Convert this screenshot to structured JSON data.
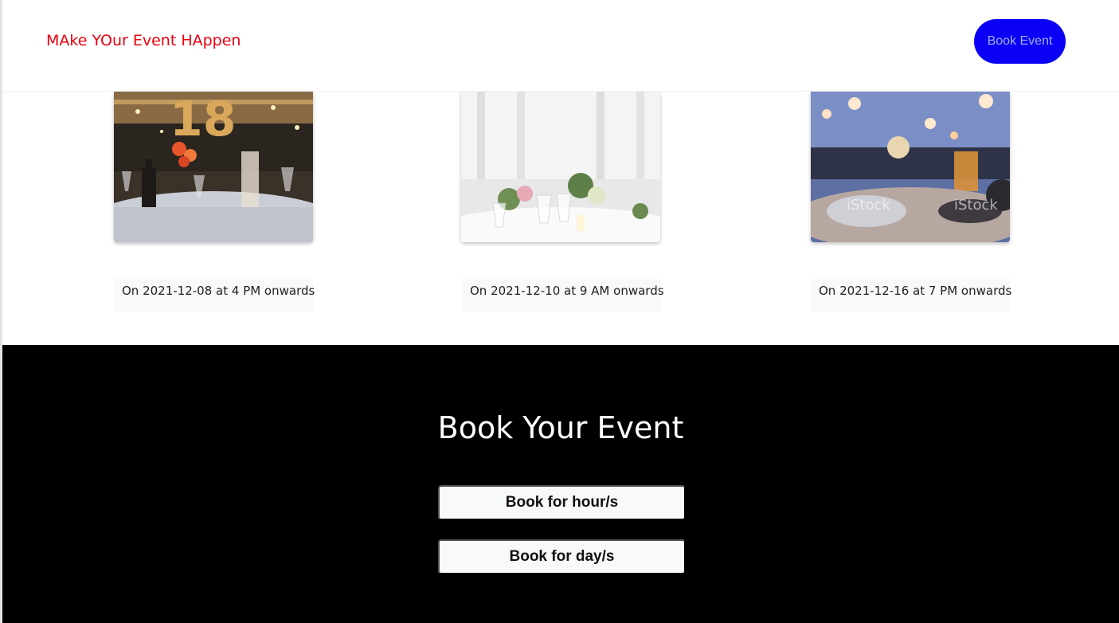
{
  "navbar": {
    "brand": "MAke YOur Event HAppen",
    "book_event_label": "Book Event",
    "colors": {
      "brand": "#e8000f",
      "button_bg": "#0a00f5",
      "button_text": "#9fb0ff"
    }
  },
  "events": [
    {
      "image": "party-table-photo",
      "date_text": "On 2021-12-08 at 4 PM onwards"
    },
    {
      "image": "wedding-table-photo",
      "date_text": "On 2021-12-10 at 9 AM onwards"
    },
    {
      "image": "outdoor-dinner-photo",
      "date_text": "On 2021-12-16 at 7 PM onwards"
    }
  ],
  "booking": {
    "title": "Book Your Event",
    "hours_button_label": "Book for hour/s",
    "days_button_label": "Book for day/s",
    "colors": {
      "section_bg": "#000000",
      "button_bg": "#f8f9fa"
    }
  }
}
